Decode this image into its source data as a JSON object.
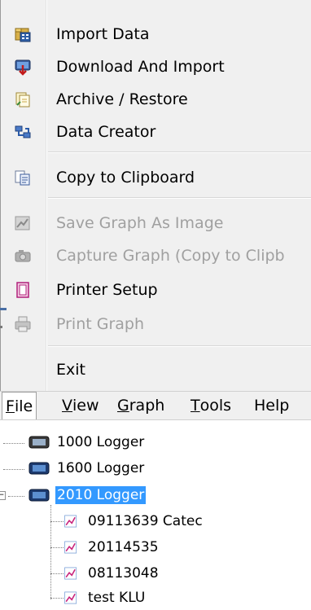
{
  "file_menu": {
    "items": [
      {
        "label": "Import Data",
        "icon": "import-data-icon",
        "enabled": true
      },
      {
        "label": "Download And Import",
        "icon": "download-import-icon",
        "enabled": true
      },
      {
        "label": "Archive / Restore",
        "icon": "archive-restore-icon",
        "enabled": true
      },
      {
        "label": "Data Creator",
        "icon": "data-creator-icon",
        "enabled": true
      },
      {
        "label": "Copy to Clipboard",
        "icon": "copy-clipboard-icon",
        "enabled": true
      },
      {
        "label": "Save Graph As Image",
        "icon": "save-graph-icon",
        "enabled": false
      },
      {
        "label": "Capture Graph (Copy to Clipb",
        "icon": "camera-icon",
        "enabled": false
      },
      {
        "label": "Printer Setup",
        "icon": "printer-setup-icon",
        "enabled": true
      },
      {
        "label": "Print Graph",
        "icon": "printer-icon",
        "enabled": false
      },
      {
        "label": "Exit",
        "icon": "",
        "enabled": true
      }
    ]
  },
  "menubar": {
    "file": {
      "accel": "F",
      "rest": "ile"
    },
    "view": {
      "accel": "V",
      "rest": "iew"
    },
    "graph": {
      "accel": "G",
      "rest": "raph"
    },
    "tools": {
      "accel": "T",
      "rest": "ools"
    },
    "help": {
      "label": "Help"
    }
  },
  "tree": {
    "loggers": [
      {
        "label": "1000 Logger",
        "selected": false
      },
      {
        "label": "1600 Logger",
        "selected": false
      },
      {
        "label": "2010 Logger",
        "selected": true
      }
    ],
    "datasets": [
      {
        "label": "09113639 Catec"
      },
      {
        "label": "20114535"
      },
      {
        "label": "08113048"
      },
      {
        "label": "test KLU"
      }
    ]
  },
  "colors": {
    "menu_bg": "#f0f0f0",
    "disabled_text": "#a0a0a0",
    "selection": "#3399ff"
  }
}
